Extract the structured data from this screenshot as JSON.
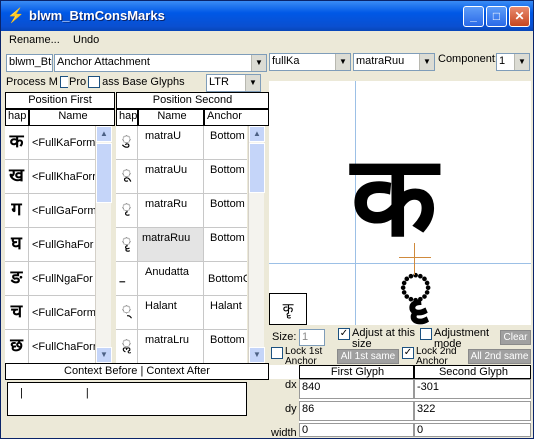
{
  "window": {
    "title": "blwm_BtmConsMarks"
  },
  "title_buttons": {
    "minimize": "_",
    "maximize": "□",
    "close": "✕"
  },
  "menu": {
    "rename": "Rename...",
    "undo": "Undo"
  },
  "controls": {
    "lookup_name": "blwm_Btm",
    "lookup_type": "Anchor Attachment",
    "process_marks": "Process M",
    "process_base": "Pro",
    "process_base_glyphs": "ass Base Glyphs",
    "direction": "LTR"
  },
  "left_headers": {
    "position_first": "Position First",
    "position_second": "Position Second",
    "shape": "hap",
    "name": "Name",
    "shape2": "hap",
    "name2": "Name",
    "anchor": "Anchor"
  },
  "first_rows": [
    {
      "glyph": "क",
      "name": "<FullKaForm"
    },
    {
      "glyph": "ख",
      "name": "<FullKhaForr"
    },
    {
      "glyph": "ग",
      "name": "<FullGaForm"
    },
    {
      "glyph": "घ",
      "name": "<FullGhaFor"
    },
    {
      "glyph": "ङ",
      "name": "<FullNgaFor"
    },
    {
      "glyph": "च",
      "name": "<FullCaForm"
    },
    {
      "glyph": "छ",
      "name": "<FullChaForr"
    }
  ],
  "second_rows": [
    {
      "glyph": "ु",
      "name": "matraU",
      "anchor": "Bottom"
    },
    {
      "glyph": "ू",
      "name": "matraUu",
      "anchor": "Bottom"
    },
    {
      "glyph": "ृ",
      "name": "matraRu",
      "anchor": "Bottom"
    },
    {
      "glyph": "ॄ",
      "name": "matraRuu",
      "anchor": "Bottom"
    },
    {
      "glyph": "॒",
      "name": "Anudatta",
      "anchor": "BottomC"
    },
    {
      "glyph": "्",
      "name": "Halant",
      "anchor": "Halant"
    },
    {
      "glyph": "ॢ",
      "name": "matraLru",
      "anchor": "Bottom"
    }
  ],
  "context": {
    "header": "Context Before | Context After",
    "before": "|",
    "after": "|"
  },
  "right_top": {
    "first_glyph": "fullKa",
    "second_glyph": "matraRuu",
    "component_label": "Component:",
    "component_value": "1"
  },
  "preview": {
    "base_glyph": "क",
    "mark_glyph": "ॄ",
    "thumb_glyph": "कॄ"
  },
  "size_row": {
    "size_label": "Size:",
    "size_value": "1",
    "adjust_label": "Adjust at this size",
    "adjustment_mode_label": "Adjustment mode",
    "clear_label": "Clear",
    "lock_first_label": "Lock 1st Anchor",
    "all_first_label": "All 1st same",
    "lock_second_label": "Lock 2nd Anchor",
    "all_second_label": "All 2nd same"
  },
  "values_table": {
    "col_first": "First Glyph",
    "col_second": "Second Glyph",
    "rows": [
      {
        "label": "dx",
        "first": "840",
        "second": "-301"
      },
      {
        "label": "dy",
        "first": "86",
        "second": "322"
      },
      {
        "label": "width",
        "first": "0",
        "second": "0"
      }
    ]
  },
  "colors": {
    "title_bar": "#0058e6",
    "guide": "#9cc0e6",
    "crosshair": "#d08a3c",
    "selected_row": "#e4e4e4"
  }
}
